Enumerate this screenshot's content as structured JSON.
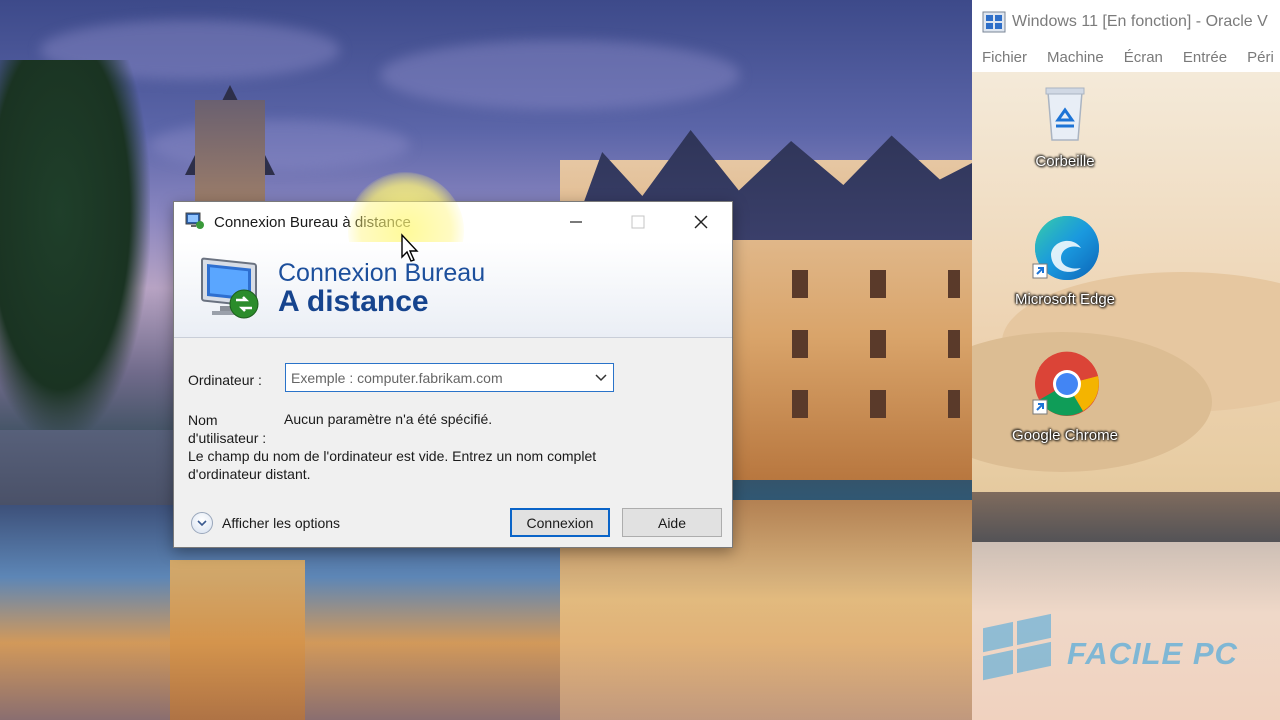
{
  "rdp": {
    "title": "Connexion Bureau à distance",
    "banner_line1": "Connexion Bureau",
    "banner_line2": "A distance",
    "computer_label": "Ordinateur :",
    "computer_placeholder": "Exemple : computer.fabrikam.com",
    "username_label": "Nom d'utilisateur :",
    "username_value": "Aucun paramètre n'a été spécifié.",
    "message": "Le champ du nom de l'ordinateur est vide. Entrez un nom complet d'ordinateur distant.",
    "show_options": "Afficher les options",
    "connect_button": "Connexion",
    "help_button": "Aide"
  },
  "vm": {
    "title": "Windows 11 [En fonction] - Oracle V",
    "menu": [
      "Fichier",
      "Machine",
      "Écran",
      "Entrée",
      "Péri"
    ],
    "desktop_icons": [
      {
        "label": "Corbeille",
        "icon": "recycle-bin-icon"
      },
      {
        "label": "Microsoft Edge",
        "icon": "edge-icon"
      },
      {
        "label": "Google Chrome",
        "icon": "chrome-icon"
      }
    ]
  },
  "watermark": "FACILE PC",
  "colors": {
    "accent_blue": "#0a64c8",
    "banner_blue": "#1c4f9c"
  }
}
